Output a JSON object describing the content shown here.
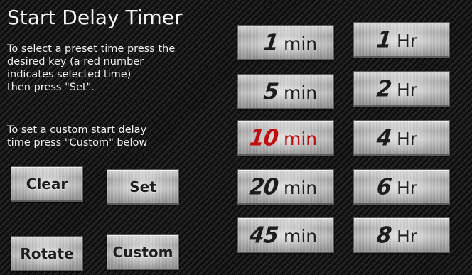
{
  "title": "Start Delay Timer",
  "instructions": {
    "preset": "To select a preset time press the\ndesired key (a red number\nindicates selected time)\nthen press \"Set\".",
    "custom": "To set a custom start delay\ntime press \"Custom\" below"
  },
  "buttons": {
    "clear": "Clear",
    "set": "Set",
    "rotate": "Rotate",
    "custom": "Custom"
  },
  "minute_presets": [
    {
      "value": "1",
      "unit": "min",
      "selected": false
    },
    {
      "value": "5",
      "unit": "min",
      "selected": false
    },
    {
      "value": "10",
      "unit": "min",
      "selected": true
    },
    {
      "value": "20",
      "unit": "min",
      "selected": false
    },
    {
      "value": "45",
      "unit": "min",
      "selected": false
    }
  ],
  "hour_presets": [
    {
      "value": "1",
      "unit": "Hr",
      "selected": false
    },
    {
      "value": "2",
      "unit": "Hr",
      "selected": false
    },
    {
      "value": "4",
      "unit": "Hr",
      "selected": false
    },
    {
      "value": "6",
      "unit": "Hr",
      "selected": false
    },
    {
      "value": "8",
      "unit": "Hr",
      "selected": false
    }
  ],
  "colors": {
    "selected_text": "#c00d0d",
    "normal_text": "#1c1c1c",
    "heading_text": "#f4f4f4"
  }
}
